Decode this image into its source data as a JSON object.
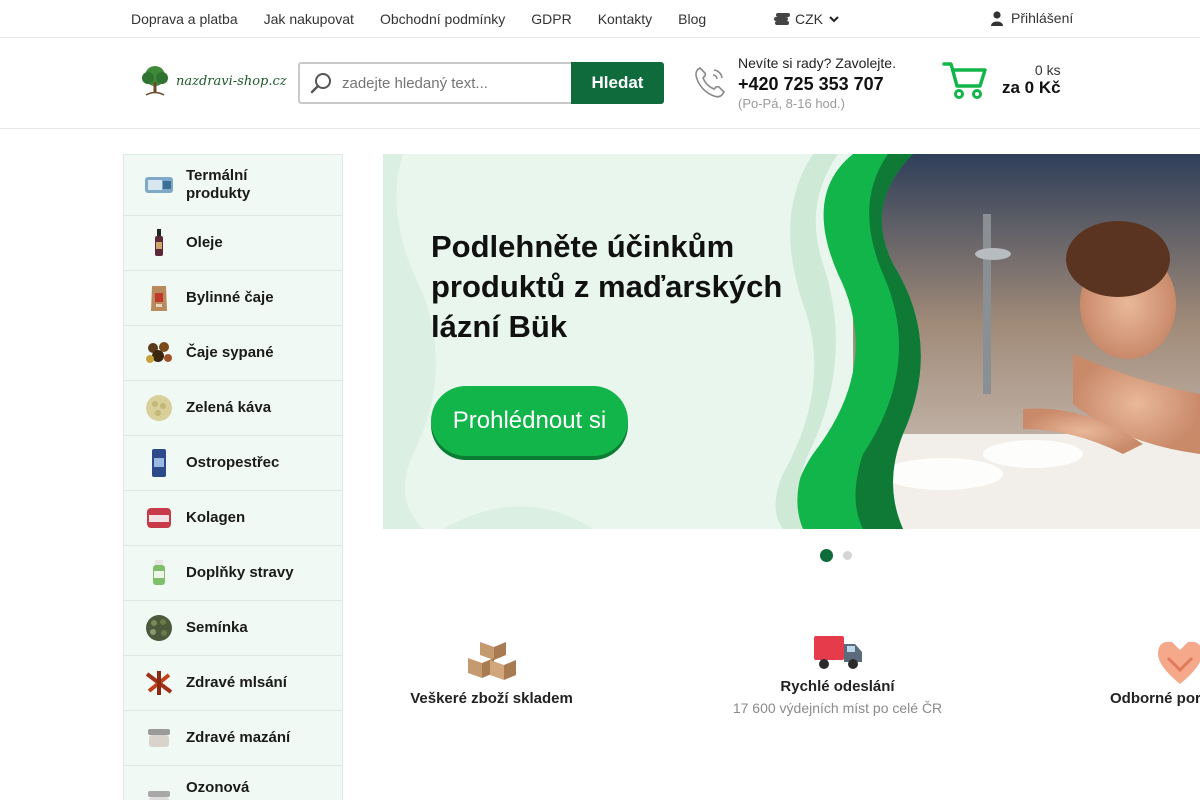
{
  "topbar": {
    "nav": [
      "Doprava a platba",
      "Jak nakupovat",
      "Obchodní podmínky",
      "GDPR",
      "Kontakty",
      "Blog"
    ],
    "currency": "CZK",
    "login": "Přihlášení"
  },
  "header": {
    "logo_text": "nazdravi-shop.cz",
    "search_placeholder": "zadejte hledaný text...",
    "search_button": "Hledat",
    "contact_question": "Nevíte si rady? Zavolejte.",
    "contact_phone": "+420 725 353 707",
    "contact_hours": "(Po-Pá, 8-16 hod.)",
    "cart_count": "0 ks",
    "cart_total": "za 0 Kč"
  },
  "sidebar": {
    "categories": [
      {
        "label": "Termální produkty",
        "icon": "thermal-product-thumb"
      },
      {
        "label": "Oleje",
        "icon": "oil-bottle-thumb"
      },
      {
        "label": "Bylinné čaje",
        "icon": "herbal-tea-thumb"
      },
      {
        "label": "Čaje sypané",
        "icon": "loose-tea-thumb"
      },
      {
        "label": "Zelená káva",
        "icon": "green-coffee-thumb"
      },
      {
        "label": "Ostropestřec",
        "icon": "milk-thistle-thumb"
      },
      {
        "label": "Kolagen",
        "icon": "collagen-thumb"
      },
      {
        "label": "Doplňky stravy",
        "icon": "supplement-thumb"
      },
      {
        "label": "Semínka",
        "icon": "seeds-thumb"
      },
      {
        "label": "Zdravé mlsání",
        "icon": "healthy-snack-thumb"
      },
      {
        "label": "Zdravé mazání",
        "icon": "healthy-spread-thumb"
      },
      {
        "label": "Ozonová",
        "icon": "ozone-thumb"
      }
    ]
  },
  "banner": {
    "title": "Podlehněte účinkům produktů z maďarských lázní Bük",
    "button": "Prohlédnout si",
    "active_slide": 1,
    "slide_count": 2
  },
  "features": [
    {
      "title": "Veškeré zboží skladem",
      "subtitle": "",
      "icon": "boxes-icon"
    },
    {
      "title": "Rychlé odeslání",
      "subtitle": "17 600 výdejních míst po celé ČR",
      "icon": "delivery-truck-icon"
    },
    {
      "title": "Odborné pora",
      "subtitle": "",
      "icon": "handshake-icon"
    }
  ],
  "colors": {
    "brand_green": "#0f6b3b",
    "accent_green": "#12b54a",
    "sidebar_bg": "#f1f9f4"
  }
}
